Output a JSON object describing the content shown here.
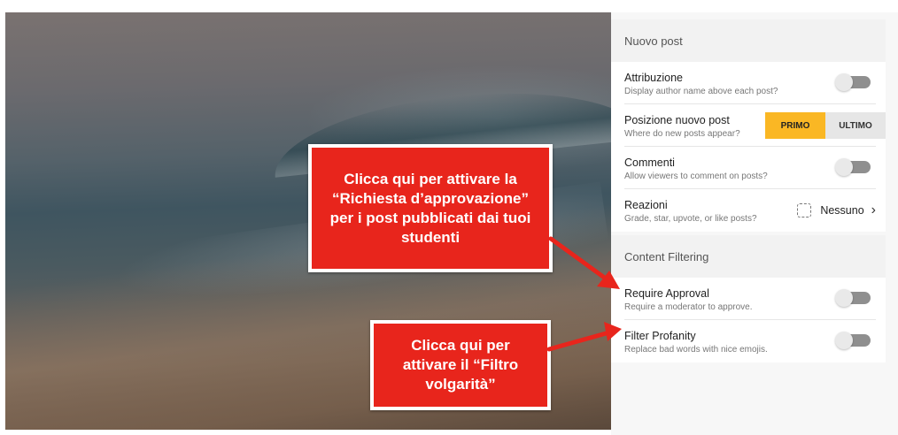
{
  "panel": {
    "sections": [
      {
        "header": "Nuovo post",
        "rows": [
          {
            "title": "Attribuzione",
            "desc": "Display author name above each post?",
            "control": "toggle",
            "on": false
          },
          {
            "title": "Posizione nuovo post",
            "desc": "Where do new posts appear?",
            "control": "segmented",
            "options": [
              "PRIMO",
              "ULTIMO"
            ],
            "selected": "PRIMO"
          },
          {
            "title": "Commenti",
            "desc": "Allow viewers to comment on posts?",
            "control": "toggle",
            "on": false
          },
          {
            "title": "Reazioni",
            "desc": "Grade, star, upvote, or like posts?",
            "control": "select",
            "value": "Nessuno",
            "icon": "dashed-square-icon"
          }
        ]
      },
      {
        "header": "Content Filtering",
        "rows": [
          {
            "title": "Require Approval",
            "desc": "Require a moderator to approve.",
            "control": "toggle",
            "on": false
          },
          {
            "title": "Filter Profanity",
            "desc": "Replace bad words with nice emojis.",
            "control": "toggle",
            "on": false
          }
        ]
      }
    ]
  },
  "callouts": {
    "approval": [
      "Clicca qui per attivare la",
      "“Richiesta d’approvazione”",
      "per i post pubblicati dai tuoi",
      "studenti"
    ],
    "profanity": [
      "Clicca qui per",
      "attivare il “Filtro",
      "volgarità”"
    ]
  },
  "colors": {
    "accent": "#fab724",
    "callout_bg": "#e8251c",
    "toggle_track": "#8f8f8f"
  }
}
